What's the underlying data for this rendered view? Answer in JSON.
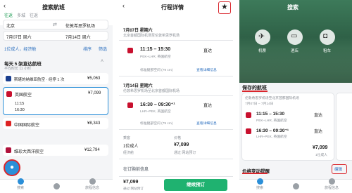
{
  "p1": {
    "title": "搜索航班",
    "trip_tabs": [
      "往返",
      "多城",
      "往返"
    ],
    "from_city": "北京",
    "to_city": "伦敦希思罗机场",
    "date_out": "7月07日 周六",
    "date_back": "7月14日 周六",
    "passengers": "1位成人，经济舱",
    "sort_label": "排序",
    "filter_label": "筛选",
    "section_title": "每天 5 架直达航班",
    "section_sub": "平均时长 11 小时",
    "results": [
      {
        "airline": "斯堪的纳维亚航空 · 经停 1 次",
        "price": "¥5,063",
        "color": "#1b3f8f"
      },
      {
        "airline": "英国航空",
        "price": "¥7,099",
        "color": "#c8102e",
        "t1": "11:15",
        "t2": "16:30"
      },
      {
        "airline": "中国国际航空",
        "price": "¥8,343",
        "color": "#d22"
      },
      {
        "airline": "维珍大西洋航空",
        "price": "¥12,794",
        "color": "#b0113b"
      }
    ],
    "tabs": [
      "搜索",
      "",
      "旅程信息"
    ]
  },
  "p2": {
    "title": "行程详情",
    "out_date": "7月07日 星期六",
    "out_route": "北京首都国际机场至伦敦希思罗机场",
    "out_time": "11:15 – 15:30",
    "out_type": "直达",
    "out_codes": "PEK–LHR, 英国航空",
    "out_baggage": "标准腿部空间 (79 cm)",
    "detail_link": "查看详细信息",
    "ret_date": "7月14日 星期六",
    "ret_route": "伦敦希思罗机场至北京首都国际机场",
    "ret_time": "16:30 – 09:30⁺¹",
    "ret_type": "直达",
    "ret_codes": "LHR–PEK, 英国航空",
    "ret_baggage": "标准腿部空间 (79 cm)",
    "pax_label": "乘客",
    "pax_value": "1位成人",
    "cabin": "经济舱",
    "price_label": "价格",
    "price_value": "¥7,099",
    "price_sub": "通过 网站预订",
    "more": "在订购前信息",
    "bottom_price": "¥7,099",
    "bottom_sub": "通过 网站预订",
    "book_button": "继续预订"
  },
  "p3": {
    "title": "搜索",
    "quick": [
      "机票",
      "酒店",
      "租车"
    ],
    "saved_title": "保存的航班",
    "saved_route": "伦敦希思罗机场至北京首都国际机场",
    "saved_dates": "7月07日 – 7月14日",
    "saved_time1": "11:15 – 15:30",
    "saved_time2": "16:30 – 09:30⁺¹",
    "saved_type": "直达",
    "saved_codes1": "PEK–LHR, 英国航空",
    "saved_codes2": "LHR–PEK, 英国航空",
    "saved_price": "¥7,099",
    "saved_sub": "1位成人",
    "price_alert": "价格变动提醒",
    "edit": "编辑",
    "tabs": [
      "搜索",
      "",
      "旅程信息"
    ]
  }
}
